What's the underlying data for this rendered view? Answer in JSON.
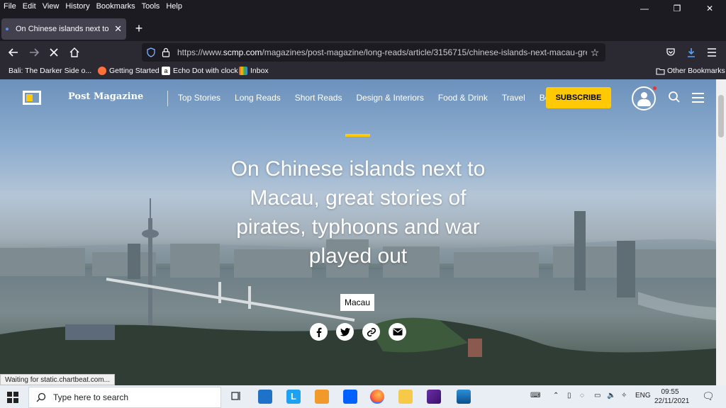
{
  "menubar": {
    "items": [
      "File",
      "Edit",
      "View",
      "History",
      "Bookmarks",
      "Tools",
      "Help"
    ]
  },
  "tab": {
    "title": "On Chinese islands next to Macau",
    "close": "✕",
    "new_tab": "+"
  },
  "address": {
    "url_prefix": "https://www.",
    "url_domain": "scmp.com",
    "url_rest": "/magazines/post-magazine/long-reads/article/3156715/chinese-islands-next-macau-great-stori"
  },
  "bookmarks": {
    "items": [
      "Bali: The Darker Side o...",
      "Getting Started",
      "Echo Dot with clock",
      "Inbox"
    ],
    "other": "Other Bookmarks"
  },
  "site": {
    "brand": "Post Magazine",
    "nav": [
      "Top Stories",
      "Long Reads",
      "Short Reads",
      "Design & Interiors",
      "Food & Drink",
      "Travel",
      "Books"
    ],
    "subscribe": "SUBSCRIBE"
  },
  "article": {
    "headline": "On Chinese islands next to Macau, great stories of pirates, typhoons and war played out",
    "tag": "Macau"
  },
  "status": {
    "text": "Waiting for static.chartbeat.com..."
  },
  "taskbar": {
    "search_placeholder": "Type here to search",
    "lang": "ENG",
    "time": "09:55",
    "date": "22/11/2021"
  },
  "colors": {
    "accent": "#ffca05",
    "toolbar": "#2b2a33",
    "tab_active": "#42414d"
  }
}
